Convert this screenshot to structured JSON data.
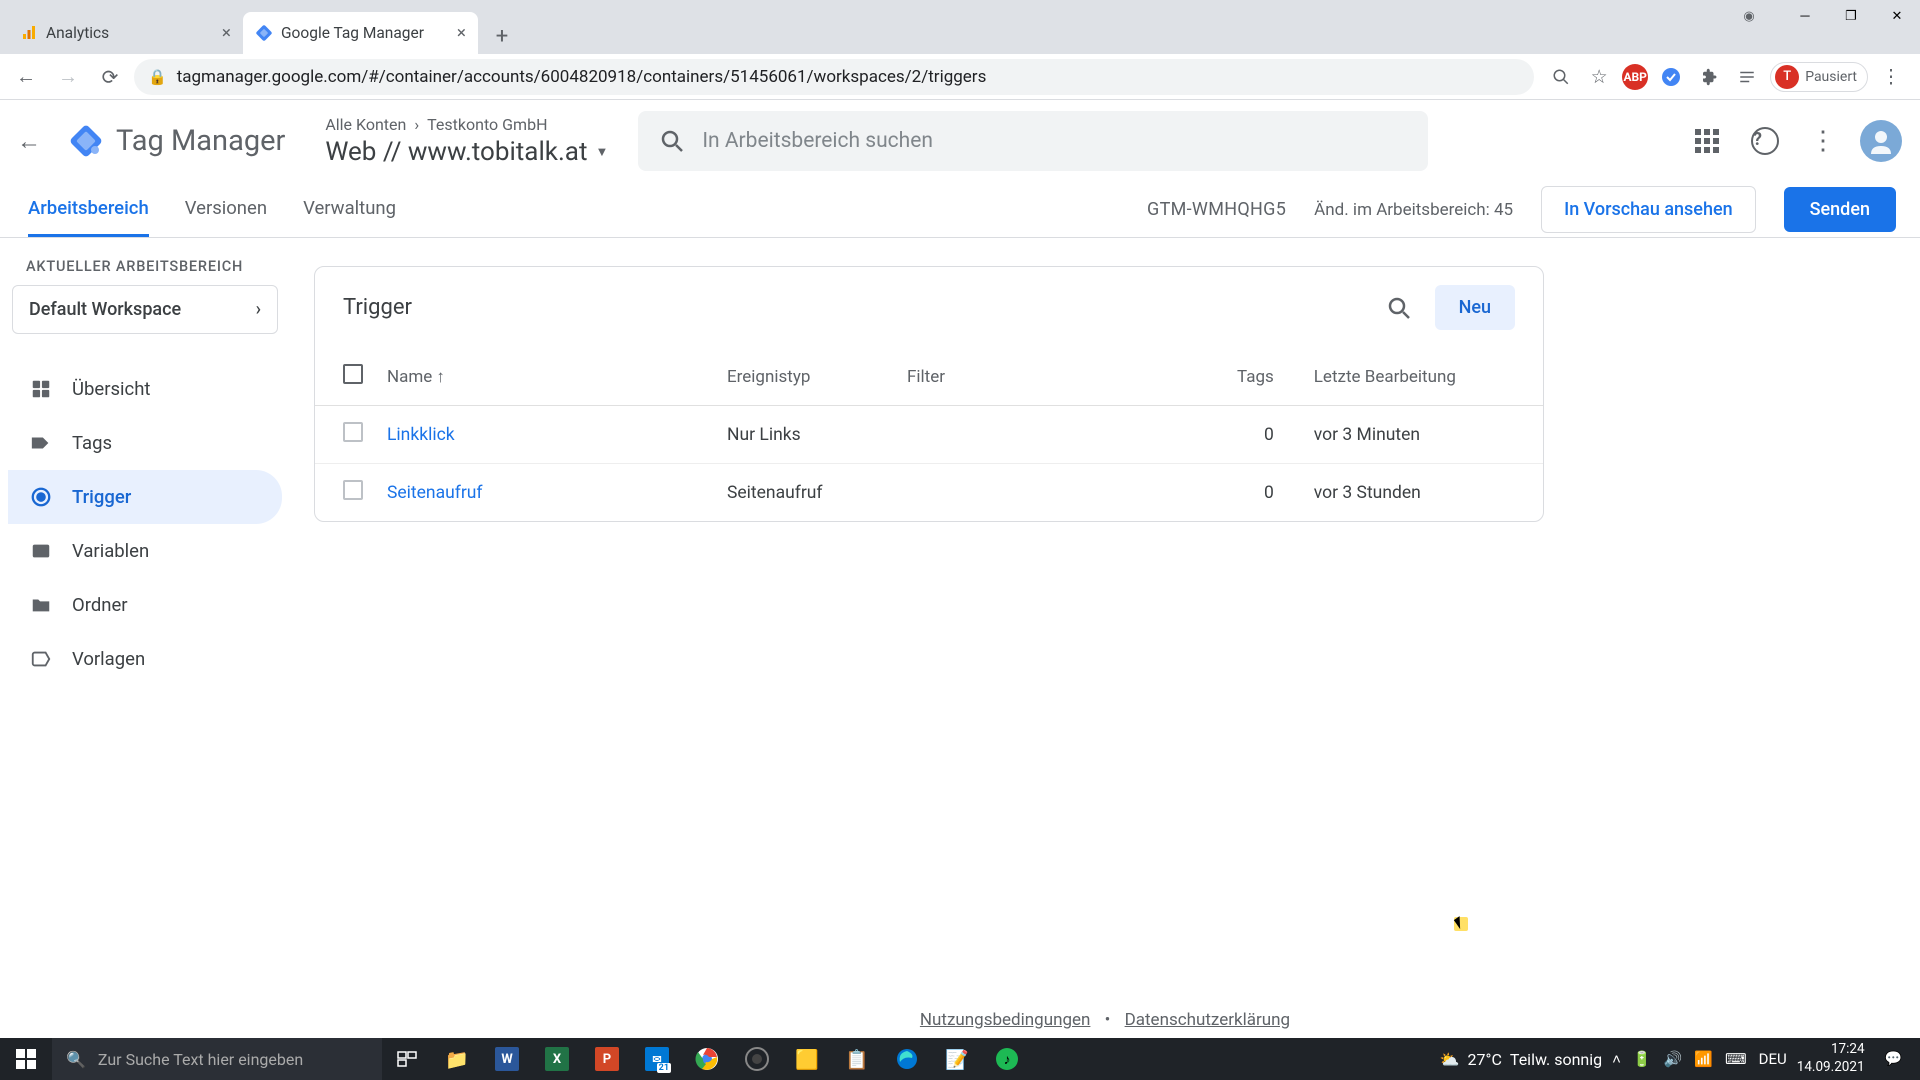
{
  "browser": {
    "tabs": [
      {
        "title": "Analytics",
        "active": false
      },
      {
        "title": "Google Tag Manager",
        "active": true
      }
    ],
    "url": "tagmanager.google.com/#/container/accounts/6004820918/containers/51456061/workspaces/2/triggers",
    "profile_status": "Pausiert",
    "profile_initial": "T"
  },
  "header": {
    "product": "Tag Manager",
    "breadcrumb_all": "Alle Konten",
    "breadcrumb_account": "Testkonto GmbH",
    "container_name": "Web // www.tobitalk.at",
    "search_placeholder": "In Arbeitsbereich suchen"
  },
  "gtm_tabs": {
    "workspace": "Arbeitsbereich",
    "versions": "Versionen",
    "admin": "Verwaltung",
    "container_id": "GTM-WMHQHG5",
    "changes": "Änd. im Arbeitsbereich: 45",
    "preview": "In Vorschau ansehen",
    "submit": "Senden"
  },
  "sidebar": {
    "ws_label": "AKTUELLER ARBEITSBEREICH",
    "ws_name": "Default Workspace",
    "items": {
      "overview": "Übersicht",
      "tags": "Tags",
      "triggers": "Trigger",
      "variables": "Variablen",
      "folders": "Ordner",
      "templates": "Vorlagen"
    }
  },
  "content": {
    "title": "Trigger",
    "new_button": "Neu",
    "columns": {
      "name": "Name",
      "event_type": "Ereignistyp",
      "filter": "Filter",
      "tags": "Tags",
      "last_edited": "Letzte Bearbeitung"
    },
    "rows": [
      {
        "name": "Linkklick",
        "event_type": "Nur Links",
        "filter": "",
        "tags": "0",
        "last_edited": "vor 3 Minuten"
      },
      {
        "name": "Seitenaufruf",
        "event_type": "Seitenaufruf",
        "filter": "",
        "tags": "0",
        "last_edited": "vor 3 Stunden"
      }
    ]
  },
  "footer": {
    "terms": "Nutzungsbedingungen",
    "privacy": "Datenschutzerklärung"
  },
  "taskbar": {
    "search_placeholder": "Zur Suche Text hier eingeben",
    "weather_temp": "27°C",
    "weather_desc": "Teilw. sonnig",
    "lang": "DEU",
    "time": "17:24",
    "date": "14.09.2021"
  }
}
